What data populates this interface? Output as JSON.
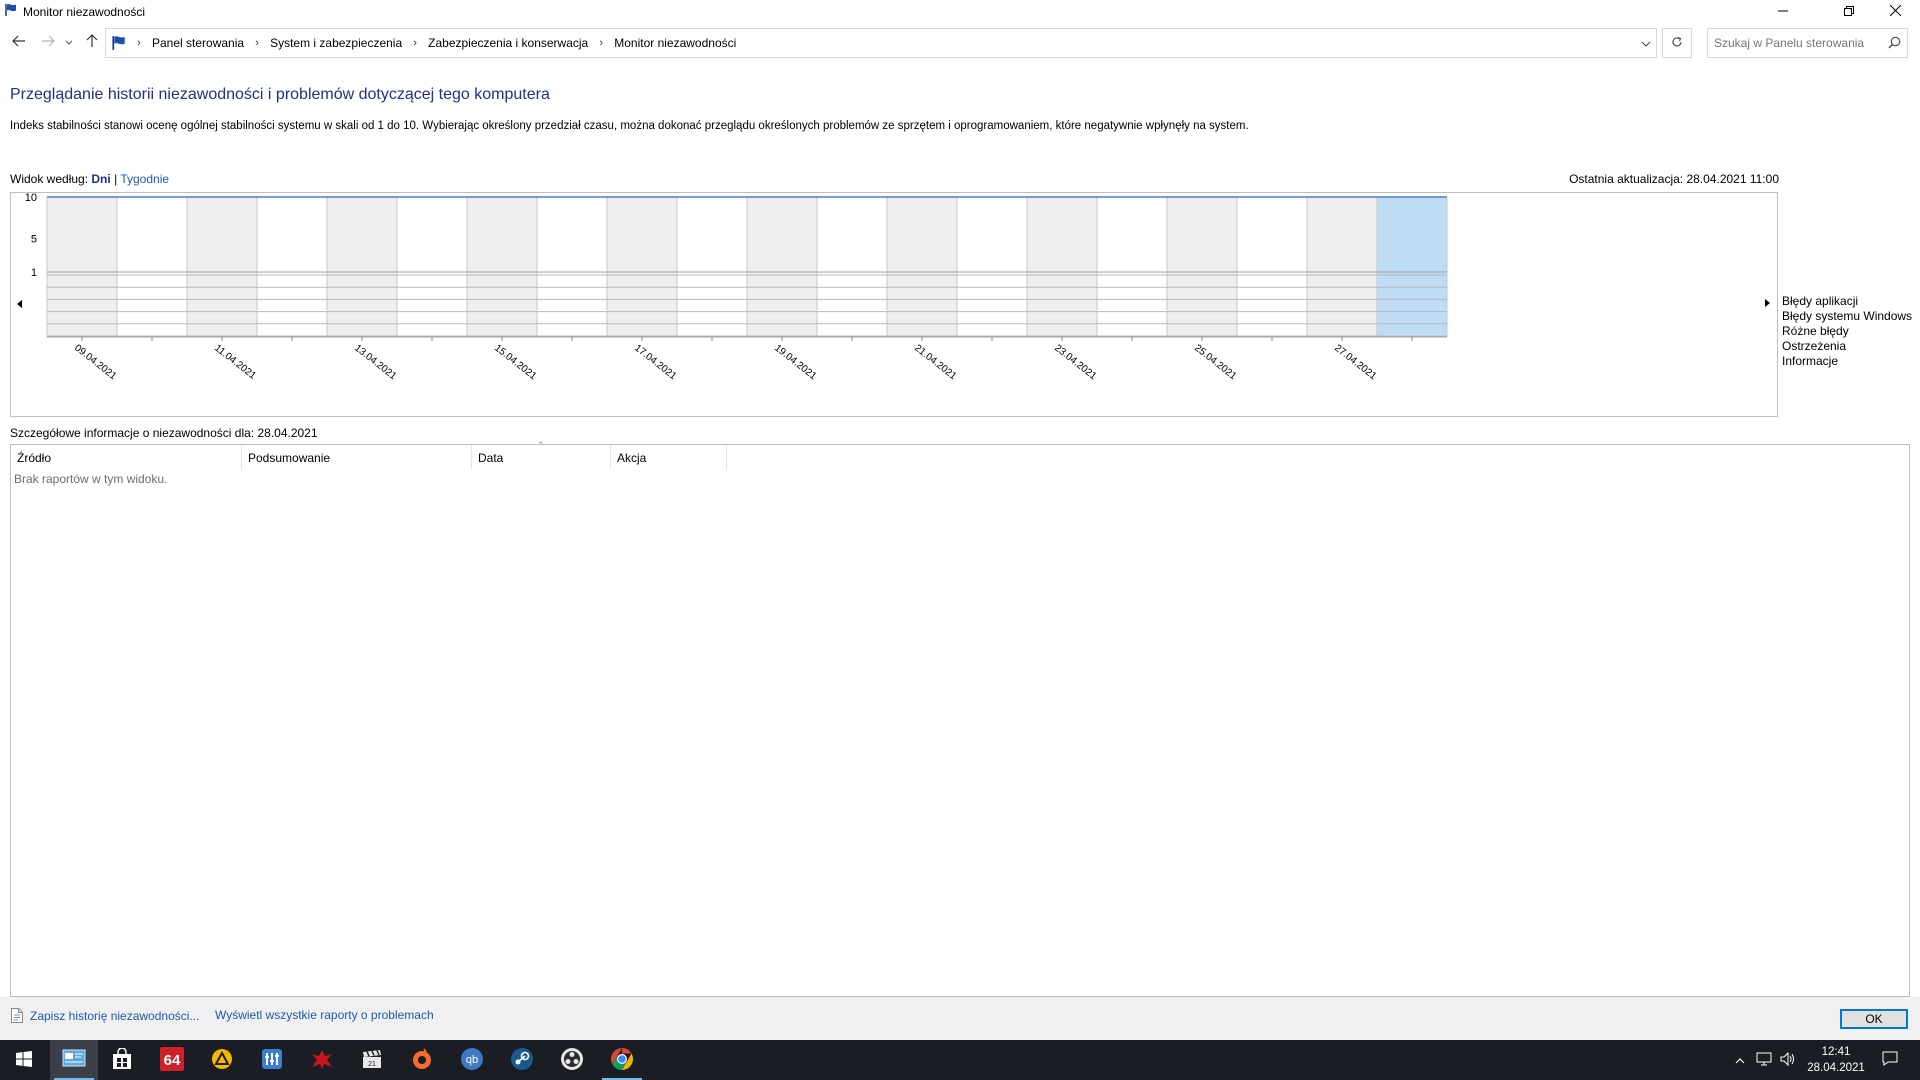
{
  "window": {
    "title": "Monitor niezawodności"
  },
  "address": {
    "crumbs": [
      "Panel sterowania",
      "System i zabezpieczenia",
      "Zabezpieczenia i konserwacja",
      "Monitor niezawodności"
    ],
    "search_placeholder": "Szukaj w Panelu sterowania"
  },
  "header": {
    "title": "Przeglądanie historii niezawodności i problemów dotyczącej tego komputera",
    "description": "Indeks stabilności stanowi ocenę ogólnej stabilności systemu w skali od 1 do 10. Wybierając określony przedział czasu, można dokonać przeglądu określonych problemów ze sprzętem i oprogramowaniem, które negatywnie wpłynęły na system."
  },
  "view": {
    "label": "Widok według:",
    "days": "Dni",
    "separator": "|",
    "weeks": "Tygodnie",
    "last_update": "Ostatnia aktualizacja: 28.04.2021 11:00"
  },
  "chart_data": {
    "type": "line",
    "y_ticks": [
      "10",
      "5",
      "1"
    ],
    "ylim": [
      1,
      10
    ],
    "columns": 20,
    "selected_column": 19,
    "x_labels": [
      "09.04.2021",
      "11.04.2021",
      "13.04.2021",
      "15.04.2021",
      "17.04.2021",
      "19.04.2021",
      "21.04.2021",
      "23.04.2021",
      "25.04.2021",
      "27.04.2021"
    ],
    "series": [
      {
        "name": "Stability index",
        "values": [
          10,
          10,
          10,
          10,
          10,
          10,
          10,
          10,
          10,
          10,
          10,
          10,
          10,
          10,
          10,
          10,
          10,
          10,
          10,
          10
        ]
      }
    ],
    "legend": [
      "Błędy aplikacji",
      "Błędy systemu Windows",
      "Różne błędy",
      "Ostrzeżenia",
      "Informacje"
    ],
    "colors": {
      "alt_column": "#efefef",
      "selected_column": "#bfdcf5",
      "line": "#4a7ec8"
    }
  },
  "details": {
    "label": "Szczegółowe informacje o niezawodności dla: 28.04.2021",
    "columns": [
      "Źródło",
      "Podsumowanie",
      "Data",
      "Akcja"
    ],
    "empty": "Brak raportów w tym widoku."
  },
  "footer": {
    "save_link": "Zapisz historię niezawodności...",
    "view_all_link": "Wyświetl wszystkie raporty o problemach",
    "ok": "OK"
  },
  "taskbar": {
    "apps": [
      "reliability-monitor",
      "store",
      "aida64",
      "app-triangle",
      "app-equalizer",
      "app-red",
      "app-clapper",
      "app-origin",
      "qbittorrent",
      "steam",
      "obs",
      "chrome"
    ],
    "time": "12:41",
    "date": "28.04.2021"
  }
}
